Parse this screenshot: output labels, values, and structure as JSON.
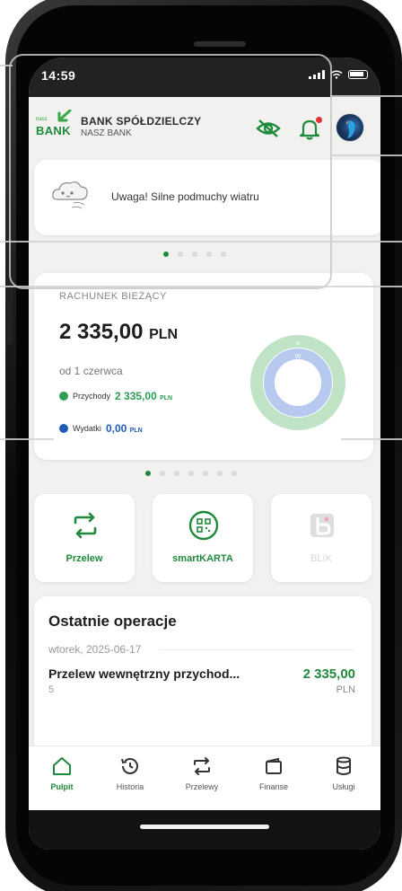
{
  "status_bar": {
    "time": "14:59"
  },
  "header": {
    "logo_top": "nasz",
    "logo_bottom": "BANK",
    "bank_name": "BANK SPÓŁDZIELCZY",
    "bank_sub": "NASZ BANK",
    "icons": [
      "eye-off-icon",
      "bell-icon",
      "avatar"
    ]
  },
  "alert": {
    "text": "Uwaga! Silne podmuchy wiatru",
    "icon": "wind-cloud-icon",
    "carousel_dots": 5,
    "active_dot": 0
  },
  "account": {
    "label": "RACHUNEK BIEŻĄCY",
    "amount": "2 335,00",
    "currency": "PLN",
    "period": "od 1 czerwca",
    "income_label": "Przychody",
    "income_value": "2 335,00",
    "income_currency": "PLN",
    "expense_label": "Wydatki",
    "expense_value": "0,00",
    "expense_currency": "PLN",
    "donut_inner_letter": "W",
    "donut_outer_letter": "P",
    "carousel_dots": 7,
    "active_dot": 0
  },
  "tiles": [
    {
      "label": "Przelew",
      "icon": "transfer-arrows-icon",
      "enabled": true
    },
    {
      "label": "smartKARTA",
      "icon": "qr-card-icon",
      "enabled": true
    },
    {
      "label": "BLIK",
      "icon": "blik-icon",
      "enabled": false
    }
  ],
  "operations": {
    "title": "Ostatnie operacje",
    "date": "wtorek, 2025-06-17",
    "items": [
      {
        "description": "Przelew wewnętrzny przychod...",
        "sub": "5",
        "amount": "2 335,00",
        "currency": "PLN"
      }
    ]
  },
  "bottom_nav": [
    {
      "label": "Pulpit",
      "icon": "home-icon",
      "active": true
    },
    {
      "label": "Historia",
      "icon": "history-clock-icon",
      "active": false
    },
    {
      "label": "Przelewy",
      "icon": "transfer-arrows-icon",
      "active": false
    },
    {
      "label": "Finanse",
      "icon": "finance-folder-icon",
      "active": false
    },
    {
      "label": "Usługi",
      "icon": "database-icon",
      "active": false
    }
  ],
  "colors": {
    "brand_green": "#1f8a3b",
    "income_green": "#2e9e52",
    "expense_blue": "#1e5bb8",
    "donut_outer": "#bfe3c4",
    "donut_inner": "#b7c9ee"
  }
}
